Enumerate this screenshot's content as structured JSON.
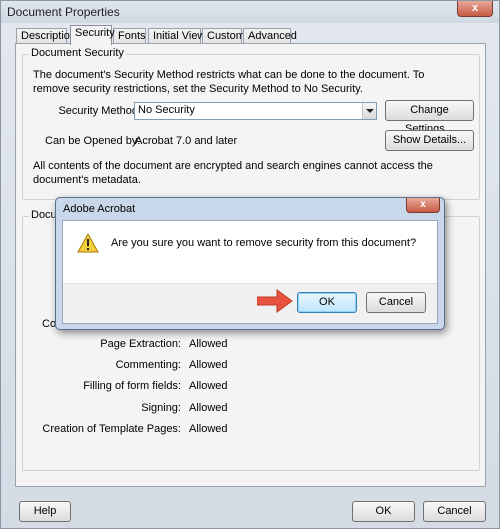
{
  "window": {
    "title": "Document Properties",
    "close_glyph": "x"
  },
  "tabs": [
    {
      "label": "Description"
    },
    {
      "label": "Security"
    },
    {
      "label": "Fonts"
    },
    {
      "label": "Initial View"
    },
    {
      "label": "Custom"
    },
    {
      "label": "Advanced"
    }
  ],
  "security_group": {
    "legend": "Document Security",
    "description": "The document's Security Method restricts what can be done to the document. To remove security restrictions, set the Security Method to No Security.",
    "method_label": "Security Method:",
    "method_value": "No Security",
    "change_settings_label": "Change Settings...",
    "opened_by_label": "Can be Opened by:",
    "opened_by_value": "Acrobat 7.0 and later",
    "show_details_label": "Show Details...",
    "encryption_note": "All contents of the document are encrypted and search engines cannot access the document's metadata."
  },
  "restrictions_group": {
    "legend_partial": "Docum",
    "hidden_row_partial": "Co",
    "rows": [
      {
        "label": "Page Extraction:",
        "value": "Allowed"
      },
      {
        "label": "Commenting:",
        "value": "Allowed"
      },
      {
        "label": "Filling of form fields:",
        "value": "Allowed"
      },
      {
        "label": "Signing:",
        "value": "Allowed"
      },
      {
        "label": "Creation of Template Pages:",
        "value": "Allowed"
      }
    ]
  },
  "footer": {
    "help_label": "Help",
    "ok_label": "OK",
    "cancel_label": "Cancel"
  },
  "dialog": {
    "title": "Adobe Acrobat",
    "close_glyph": "x",
    "message": "Are you sure you want to remove security from this document?",
    "ok_label": "OK",
    "cancel_label": "Cancel",
    "icon": "warning-icon",
    "annotation": "arrow-pointer-icon",
    "arrow_color": "#e8533f"
  },
  "colors": {
    "accent": "#3c7fb1",
    "dialog_frame": "#c8d7ea"
  }
}
